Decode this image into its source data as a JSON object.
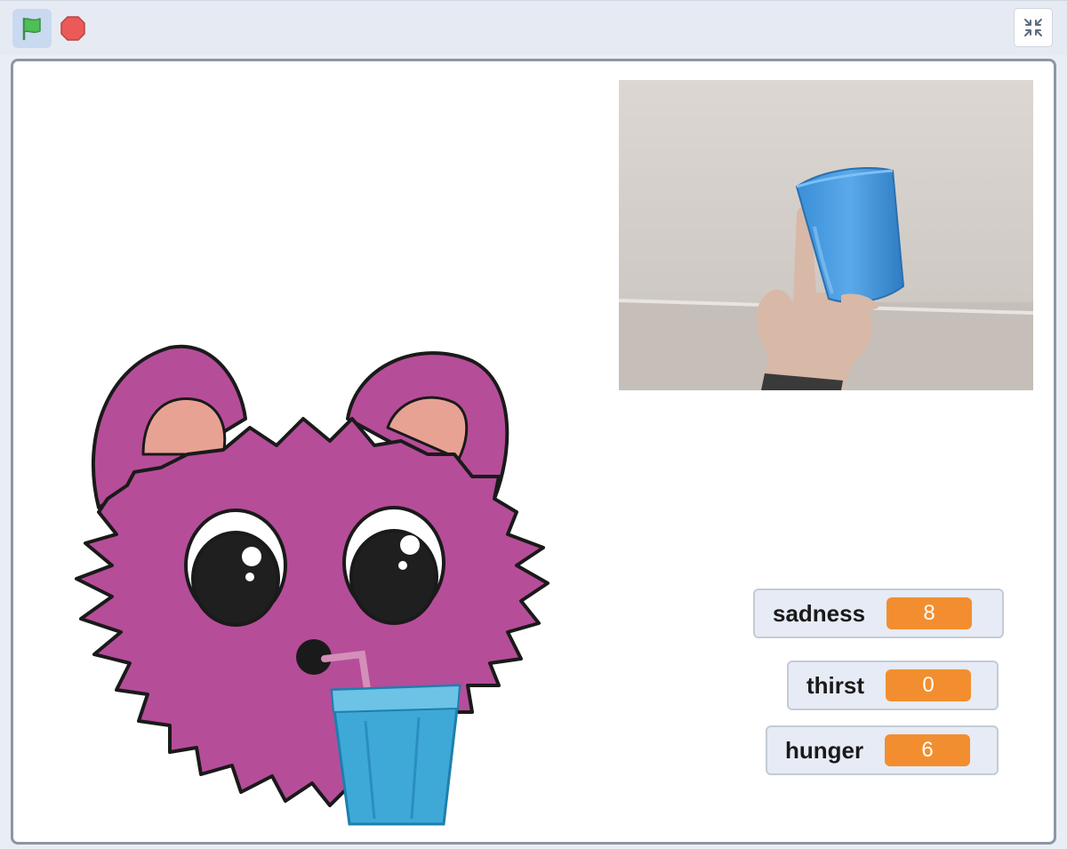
{
  "toolbar": {
    "green_flag_icon": "green-flag-icon",
    "stop_icon": "stop-sign-icon",
    "fullscreen_icon": "exit-fullscreen-icon"
  },
  "colors": {
    "flag_green": "#4cbf56",
    "stop_red": "#ec5959",
    "monitor_value_bg": "#f28e2f",
    "monster_pink": "#b64d99"
  },
  "stage": {
    "monitors": [
      {
        "label": "sadness",
        "value": "8"
      },
      {
        "label": "thirst",
        "value": "0"
      },
      {
        "label": "hunger",
        "value": "6"
      }
    ]
  }
}
